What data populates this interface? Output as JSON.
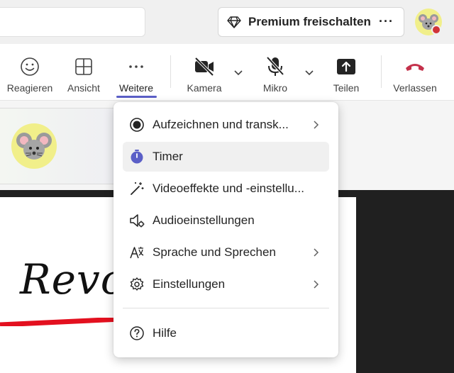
{
  "header": {
    "premium_label": "Premium freischalten",
    "more_label": "···"
  },
  "toolbar": {
    "react_label": "Reagieren",
    "view_label": "Ansicht",
    "more_label": "Weitere",
    "more_dots": "···",
    "camera_label": "Kamera",
    "mic_label": "Mikro",
    "share_label": "Teilen",
    "leave_label": "Verlassen"
  },
  "whiteboard": {
    "text": "Revolu"
  },
  "menu": {
    "items": [
      {
        "label": "Aufzeichnen und transk...",
        "icon": "record-icon",
        "submenu": true
      },
      {
        "label": "Timer",
        "icon": "timer-icon",
        "submenu": false,
        "highlighted": true
      },
      {
        "label": "Videoeffekte und -einstellu...",
        "icon": "magic-wand-icon",
        "submenu": false
      },
      {
        "label": "Audioeinstellungen",
        "icon": "speaker-settings-icon",
        "submenu": false
      },
      {
        "label": "Sprache und Sprechen",
        "icon": "language-icon",
        "submenu": true
      },
      {
        "label": "Einstellungen",
        "icon": "gear-icon",
        "submenu": true
      },
      {
        "label": "Hilfe",
        "icon": "help-icon",
        "submenu": false
      }
    ]
  },
  "colors": {
    "accent": "#5b5fc7",
    "leave_red": "#c4314b",
    "presence_busy": "#d13438"
  }
}
